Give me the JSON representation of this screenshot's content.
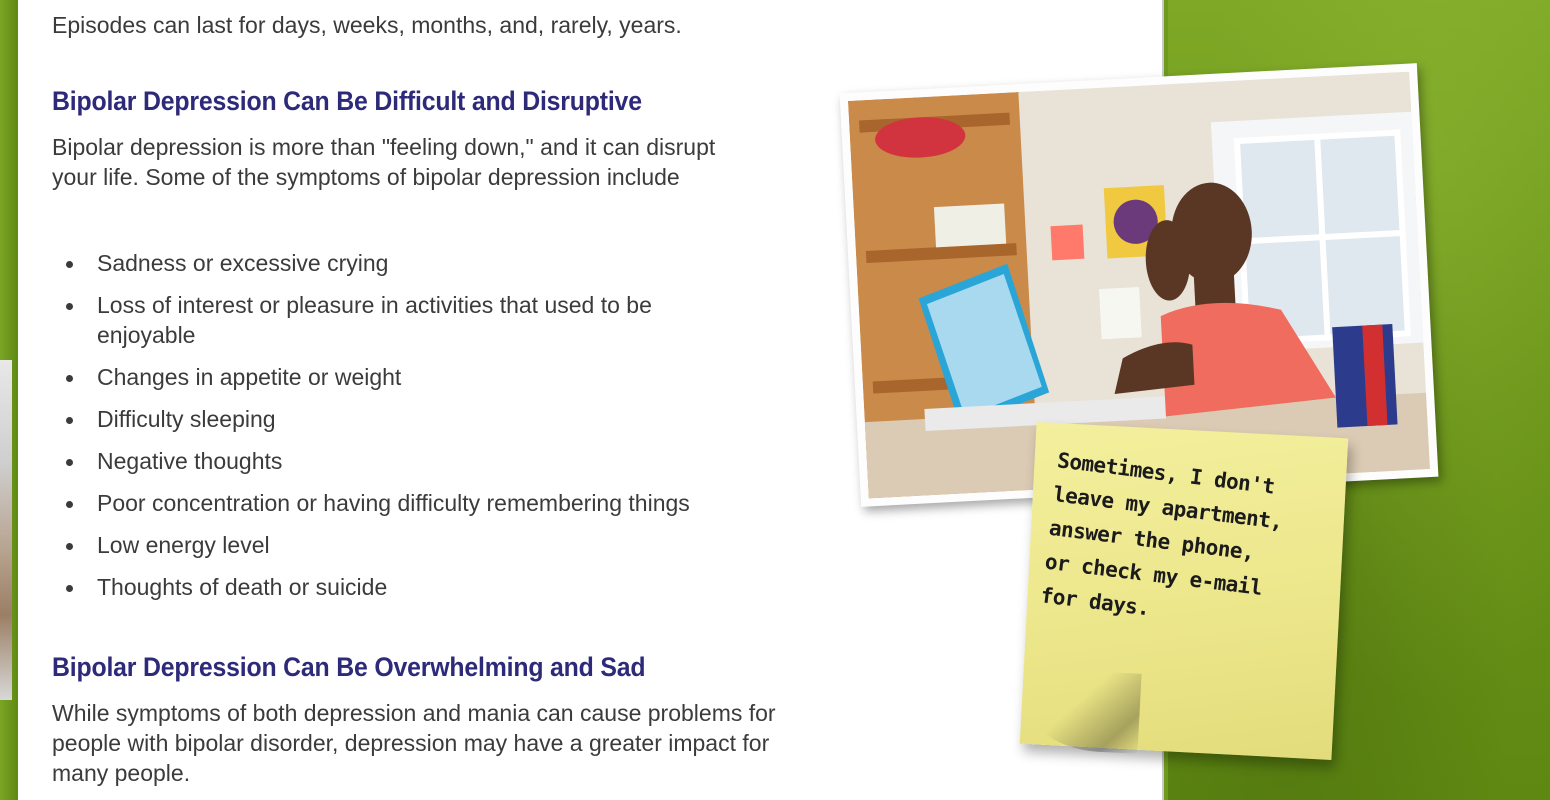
{
  "intro_line": "Episodes can last for days, weeks, months, and, rarely, years.",
  "section1": {
    "heading": "Bipolar Depression Can Be Difficult and Disruptive",
    "paragraph": "Bipolar depression is more than \"feeling down,\" and it can disrupt your life. Some of the symptoms of bipolar depression include",
    "symptoms": [
      "Sadness or excessive crying",
      "Loss of interest or pleasure in activities that used to be enjoyable",
      "Changes in appetite or weight",
      "Difficulty sleeping",
      "Negative thoughts",
      "Poor concentration or having difficulty remembering things",
      "Low energy level",
      "Thoughts of death or suicide"
    ]
  },
  "section2": {
    "heading": "Bipolar Depression Can Be Overwhelming and Sad",
    "paragraph": "While symptoms of both depression and mania can cause problems for people with bipolar disorder, depression may have a greater impact for many people."
  },
  "sticky_note": {
    "text": "Sometimes, I don't\nleave my apartment,\nanswer the phone,\nor check my e-mail\nfor days."
  },
  "colors": {
    "heading": "#2e2a7a",
    "body_text": "#3b3b3b",
    "background_green": "#6f9a1d",
    "sticky_yellow": "#f0eb92"
  }
}
